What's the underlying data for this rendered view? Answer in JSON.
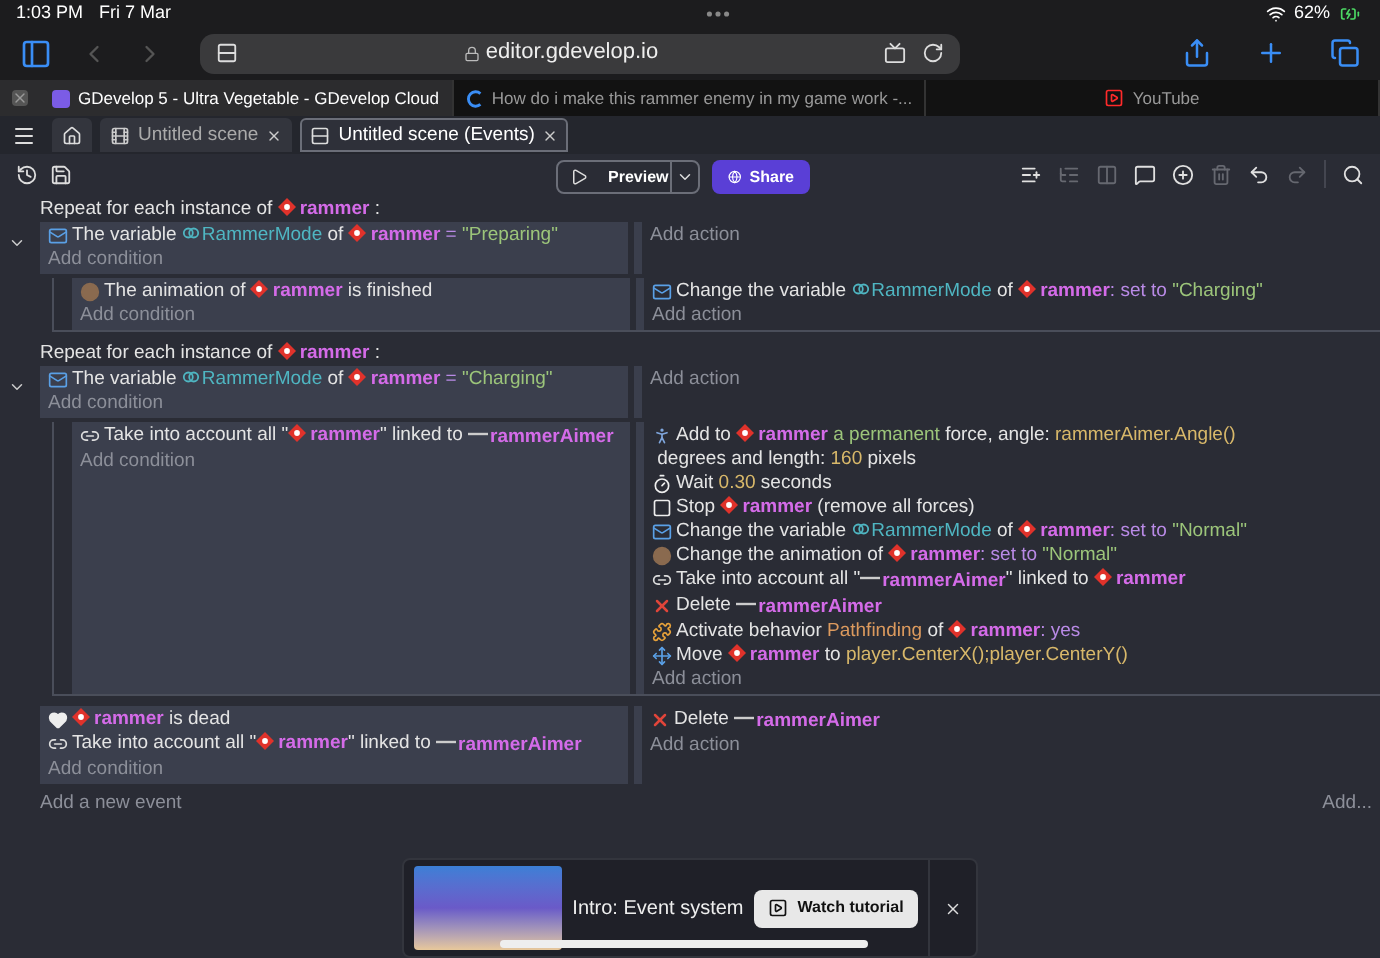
{
  "status_bar": {
    "time": "1:03 PM",
    "date": "Fri 7 Mar",
    "battery": "62%"
  },
  "browser": {
    "url": "editor.gdevelop.io",
    "tabs": [
      {
        "title": "GDevelop 5 - Ultra Vegetable - GDevelop Cloud",
        "kind": "gdevelop",
        "selected": true
      },
      {
        "title": "How do i make this rammer enemy in my game work -...",
        "kind": "forum",
        "selected": false
      },
      {
        "title": "YouTube",
        "kind": "youtube",
        "selected": false
      }
    ]
  },
  "editor_tabs": [
    {
      "kind": "home",
      "selected": false
    },
    {
      "kind": "scene",
      "label": "Untitled scene",
      "selected": false
    },
    {
      "kind": "events",
      "label": "Untitled scene (Events)",
      "selected": true
    }
  ],
  "toolbar": {
    "preview": "Preview",
    "share": "Share",
    "tools": [
      {
        "kind": "add-event",
        "disabled": false
      },
      {
        "kind": "add-subevent",
        "disabled": true
      },
      {
        "kind": "add-other",
        "disabled": true
      },
      {
        "kind": "comment",
        "disabled": false
      },
      {
        "kind": "add",
        "disabled": false
      },
      {
        "kind": "delete",
        "disabled": true
      },
      {
        "kind": "undo",
        "disabled": false
      },
      {
        "kind": "redo",
        "disabled": true
      }
    ]
  },
  "events": [
    {
      "expanded": true,
      "add_condition": "Add condition",
      "add_action": "Add action",
      "header": [
        {
          "kind": "text",
          "text": "Repeat for each instance of "
        },
        {
          "kind": "object",
          "text": "rammer"
        },
        {
          "kind": "text",
          "text": " :"
        }
      ],
      "conditions": [
        {
          "kind": "variable",
          "segments": [
            {
              "kind": "text",
              "text": "The variable "
            },
            {
              "kind": "variable",
              "text": "RammerMode"
            },
            {
              "kind": "text",
              "text": " of "
            },
            {
              "kind": "object",
              "text": "rammer"
            },
            {
              "kind": "keyword",
              "text": " = "
            },
            {
              "kind": "string",
              "text": "\"Preparing\""
            }
          ]
        }
      ],
      "children": [
        {
          "add_condition": "Add condition",
          "add_action": "Add action",
          "conditions": [
            {
              "kind": "animation",
              "segments": [
                {
                  "kind": "text",
                  "text": "The animation of "
                },
                {
                  "kind": "object",
                  "text": "rammer"
                },
                {
                  "kind": "text",
                  "text": " is finished"
                }
              ]
            }
          ],
          "actions": [
            {
              "kind": "variable",
              "segments": [
                {
                  "kind": "text",
                  "text": "Change the variable "
                },
                {
                  "kind": "variable",
                  "text": "RammerMode"
                },
                {
                  "kind": "text",
                  "text": " of "
                },
                {
                  "kind": "object",
                  "text": "rammer"
                },
                {
                  "kind": "keyword",
                  "text": ": set to "
                },
                {
                  "kind": "string",
                  "text": "\"Charging\""
                }
              ]
            }
          ]
        }
      ]
    },
    {
      "expanded": true,
      "add_condition": "Add condition",
      "add_action": "Add action",
      "header": [
        {
          "kind": "text",
          "text": "Repeat for each instance of "
        },
        {
          "kind": "object",
          "text": "rammer"
        },
        {
          "kind": "text",
          "text": " :"
        }
      ],
      "conditions": [
        {
          "kind": "variable",
          "segments": [
            {
              "kind": "text",
              "text": "The variable "
            },
            {
              "kind": "variable",
              "text": "RammerMode"
            },
            {
              "kind": "text",
              "text": " of "
            },
            {
              "kind": "object",
              "text": "rammer"
            },
            {
              "kind": "keyword",
              "text": " = "
            },
            {
              "kind": "string",
              "text": "\"Charging\""
            }
          ]
        }
      ],
      "children": [
        {
          "add_condition": "Add condition",
          "add_action": "Add action",
          "conditions": [
            {
              "kind": "link",
              "segments": [
                {
                  "kind": "text",
                  "text": "Take into account all \""
                },
                {
                  "kind": "object",
                  "text": "rammer"
                },
                {
                  "kind": "text",
                  "text": "\" linked to "
                },
                {
                  "kind": "object_line",
                  "text": "rammerAimer"
                }
              ]
            }
          ],
          "actions": [
            {
              "kind": "force",
              "segments": [
                {
                  "kind": "text",
                  "text": "Add to "
                },
                {
                  "kind": "object",
                  "text": "rammer"
                },
                {
                  "kind": "string",
                  "text": " a permanent"
                },
                {
                  "kind": "text",
                  "text": " force, angle: "
                },
                {
                  "kind": "expression",
                  "text": "rammerAimer.Angle()"
                },
                {
                  "kind": "text",
                  "text": " degrees and length: "
                },
                {
                  "kind": "expression",
                  "text": "160"
                },
                {
                  "kind": "text",
                  "text": " pixels"
                }
              ]
            },
            {
              "kind": "wait",
              "segments": [
                {
                  "kind": "text",
                  "text": "Wait "
                },
                {
                  "kind": "expression",
                  "text": "0.30"
                },
                {
                  "kind": "text",
                  "text": " seconds"
                }
              ]
            },
            {
              "kind": "stop",
              "segments": [
                {
                  "kind": "text",
                  "text": "Stop "
                },
                {
                  "kind": "object",
                  "text": "rammer"
                },
                {
                  "kind": "text",
                  "text": " (remove all forces)"
                }
              ]
            },
            {
              "kind": "variable",
              "segments": [
                {
                  "kind": "text",
                  "text": "Change the variable "
                },
                {
                  "kind": "variable",
                  "text": "RammerMode"
                },
                {
                  "kind": "text",
                  "text": " of "
                },
                {
                  "kind": "object",
                  "text": "rammer"
                },
                {
                  "kind": "keyword",
                  "text": ": set to "
                },
                {
                  "kind": "string",
                  "text": "\"Normal\""
                }
              ]
            },
            {
              "kind": "animation",
              "segments": [
                {
                  "kind": "text",
                  "text": "Change the animation of "
                },
                {
                  "kind": "object",
                  "text": "rammer"
                },
                {
                  "kind": "keyword",
                  "text": ": set to "
                },
                {
                  "kind": "string",
                  "text": "\"Normal\""
                }
              ]
            },
            {
              "kind": "link",
              "segments": [
                {
                  "kind": "text",
                  "text": "Take into account all \""
                },
                {
                  "kind": "object_line",
                  "text": "rammerAimer"
                },
                {
                  "kind": "text",
                  "text": "\" linked to "
                },
                {
                  "kind": "object",
                  "text": "rammer"
                }
              ]
            },
            {
              "kind": "delete",
              "segments": [
                {
                  "kind": "text",
                  "text": "Delete "
                },
                {
                  "kind": "object_line",
                  "text": "rammerAimer"
                }
              ]
            },
            {
              "kind": "behavior",
              "segments": [
                {
                  "kind": "text",
                  "text": "Activate behavior "
                },
                {
                  "kind": "behavior",
                  "text": "Pathfinding"
                },
                {
                  "kind": "text",
                  "text": " of "
                },
                {
                  "kind": "object",
                  "text": "rammer"
                },
                {
                  "kind": "keyword",
                  "text": ": yes"
                }
              ]
            },
            {
              "kind": "move",
              "segments": [
                {
                  "kind": "text",
                  "text": "Move "
                },
                {
                  "kind": "object",
                  "text": "rammer"
                },
                {
                  "kind": "text",
                  "text": " to "
                },
                {
                  "kind": "expression",
                  "text": "player.CenterX();player.CenterY()"
                }
              ]
            }
          ]
        }
      ]
    },
    {
      "add_condition": "Add condition",
      "add_action": "Add action",
      "conditions": [
        {
          "kind": "dead",
          "segments": [
            {
              "kind": "object",
              "text": "rammer"
            },
            {
              "kind": "text",
              "text": " is dead"
            }
          ]
        },
        {
          "kind": "link",
          "segments": [
            {
              "kind": "text",
              "text": "Take into account all \""
            },
            {
              "kind": "object",
              "text": "rammer"
            },
            {
              "kind": "text",
              "text": "\" linked to "
            },
            {
              "kind": "object_line",
              "text": "rammerAimer"
            }
          ]
        }
      ],
      "actions": [
        {
          "kind": "delete",
          "segments": [
            {
              "kind": "text",
              "text": "Delete "
            },
            {
              "kind": "object_line",
              "text": "rammerAimer"
            }
          ]
        }
      ]
    }
  ],
  "add_event": "Add a new event",
  "add_more": "Add...",
  "tutorial": {
    "title": "Intro: Event system",
    "button": "Watch tutorial"
  }
}
